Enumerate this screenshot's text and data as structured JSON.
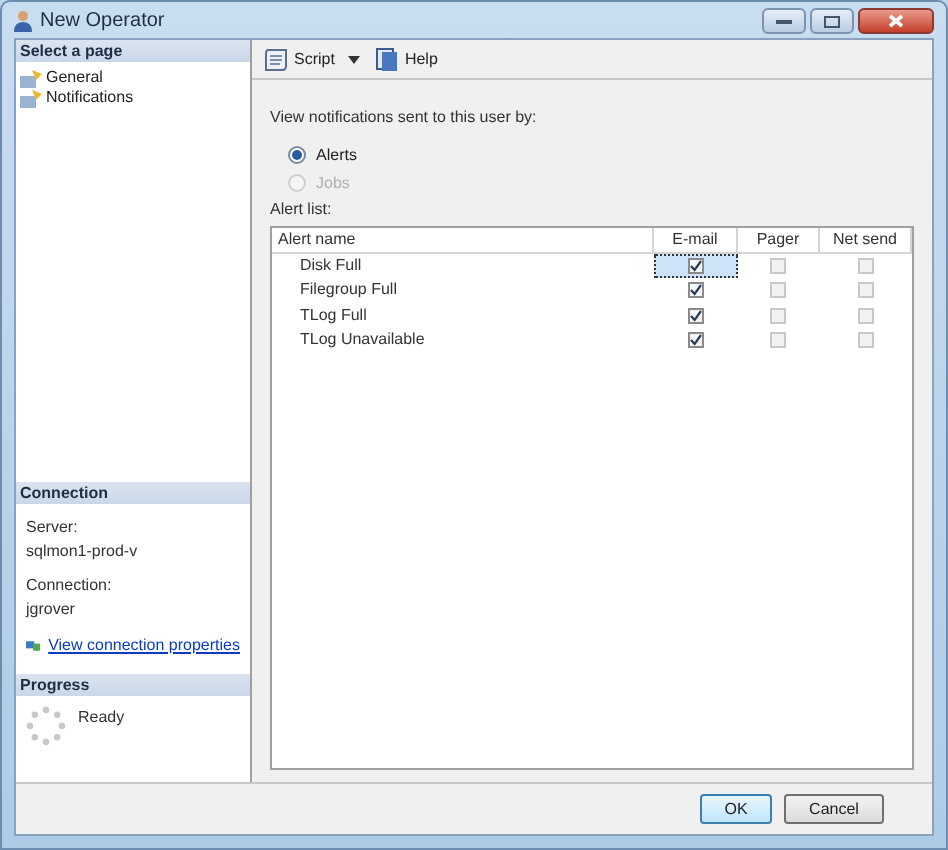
{
  "window": {
    "title": "New Operator"
  },
  "sidebar": {
    "header": "Select a page",
    "items": [
      {
        "label": "General"
      },
      {
        "label": "Notifications"
      }
    ]
  },
  "connection": {
    "header": "Connection",
    "server_label": "Server:",
    "server": "sqlmon1-prod-v",
    "connection_label": "Connection:",
    "user": "jgrover",
    "link": "View connection properties"
  },
  "progress": {
    "header": "Progress",
    "status": "Ready"
  },
  "toolbar": [
    {
      "kind": "dropdown",
      "label": "Script"
    },
    {
      "kind": "button",
      "label": "Help"
    }
  ],
  "notify_label": "View notifications sent to this user by:",
  "radios": [
    {
      "label": "Alerts",
      "selected": true,
      "disabled": false
    },
    {
      "label": "Jobs",
      "selected": false,
      "disabled": true
    }
  ],
  "list_label": "Alert list:",
  "table": {
    "columns": [
      "Alert name",
      "E-mail",
      "Pager",
      "Net send"
    ],
    "rows": [
      {
        "name": "Disk Full",
        "cells": [
          {
            "checked": true,
            "disabled": false,
            "selected": true
          },
          {
            "checked": false,
            "disabled": true,
            "selected": false
          },
          {
            "checked": false,
            "disabled": true,
            "selected": false
          }
        ]
      },
      {
        "name": "Filegroup Full",
        "cells": [
          {
            "checked": true,
            "disabled": false,
            "selected": false
          },
          {
            "checked": false,
            "disabled": true,
            "selected": false
          },
          {
            "checked": false,
            "disabled": true,
            "selected": false
          }
        ]
      },
      {
        "name": "TLog Full",
        "cells": [
          {
            "checked": true,
            "disabled": false,
            "selected": false
          },
          {
            "checked": false,
            "disabled": true,
            "selected": false
          },
          {
            "checked": false,
            "disabled": true,
            "selected": false
          }
        ]
      },
      {
        "name": "TLog Unavailable",
        "cells": [
          {
            "checked": true,
            "disabled": false,
            "selected": false
          },
          {
            "checked": false,
            "disabled": true,
            "selected": false
          },
          {
            "checked": false,
            "disabled": true,
            "selected": false
          }
        ]
      }
    ]
  },
  "buttons": [
    {
      "label": "OK",
      "default": true
    },
    {
      "label": "Cancel",
      "default": false
    }
  ]
}
